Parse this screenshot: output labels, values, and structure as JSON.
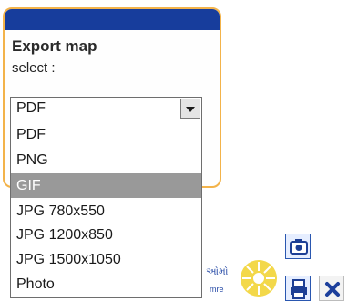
{
  "panel": {
    "title": "Export map",
    "subtitle": "select :"
  },
  "format_select": {
    "value": "PDF",
    "options": [
      "PDF",
      "PNG",
      "GIF",
      "JPG 780x550",
      "JPG 1200x850",
      "JPG 1500x1050",
      "Photo"
    ],
    "highlighted_option": "GIF"
  },
  "footer_logo": {
    "line1": "ઓમો",
    "line2": "mre"
  },
  "toolbar": {
    "icons": [
      "camera-icon",
      "print-icon",
      "close-icon"
    ]
  },
  "colors": {
    "header_blue": "#173d9c",
    "panel_border": "#f3b34a",
    "highlight_gray": "#999999",
    "close_blue": "#1c3f9c",
    "logo_yellow": "#f3d84a"
  }
}
